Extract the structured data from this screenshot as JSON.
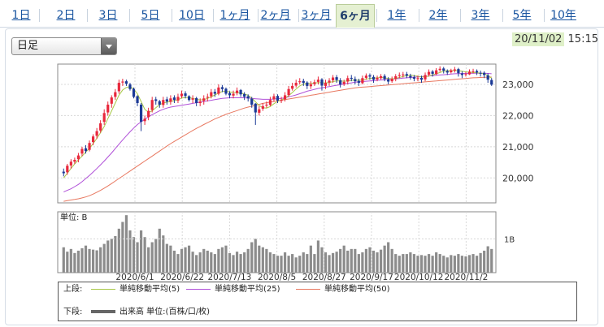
{
  "tabs": [
    {
      "label": "1日",
      "active": false
    },
    {
      "label": "2日",
      "active": false
    },
    {
      "label": "3日",
      "active": false
    },
    {
      "label": "5日",
      "active": false
    },
    {
      "label": "10日",
      "active": false
    },
    {
      "label": "1ヶ月",
      "active": false
    },
    {
      "label": "2ヶ月",
      "active": false
    },
    {
      "label": "3ヶ月",
      "active": false
    },
    {
      "label": "6ヶ月",
      "active": true
    },
    {
      "label": "1年",
      "active": false
    },
    {
      "label": "2年",
      "active": false
    },
    {
      "label": "3年",
      "active": false
    },
    {
      "label": "5年",
      "active": false
    },
    {
      "label": "10年",
      "active": false
    }
  ],
  "period_select": {
    "value": "日足"
  },
  "datetime": {
    "date": "20/11/02",
    "time": "15:15"
  },
  "legend": {
    "upper_label": "上段:",
    "lower_label": "下段:",
    "upper_items": [
      {
        "name": "単純移動平均(5)",
        "color": "#a8c848"
      },
      {
        "name": "単純移動平均(25)",
        "color": "#b050d8"
      },
      {
        "name": "単純移動平均(50)",
        "color": "#e87860"
      }
    ],
    "lower_item": {
      "name": "出来高 単位:(百株/口/枚)",
      "color": "#666666"
    }
  },
  "chart_data": {
    "type": "candlestick",
    "price_axis": {
      "ticks": [
        "20,000",
        "21,000",
        "22,000",
        "23,000"
      ],
      "ylim": [
        19200,
        23650
      ]
    },
    "volume_axis": {
      "unit_label": "単位: B",
      "ticks": [
        "1B"
      ],
      "ylim": [
        0,
        1.8
      ]
    },
    "x_labels": [
      "2020/6/1",
      "2020/6/22",
      "2020/7/13",
      "2020/8/5",
      "2020/8/27",
      "2020/9/17",
      "2020/10/12",
      "2020/11/2"
    ],
    "candles": {
      "close": [
        20150,
        20390,
        20520,
        20580,
        20720,
        20930,
        20860,
        21120,
        21330,
        21500,
        21750,
        22080,
        22350,
        22580,
        22750,
        23050,
        23090,
        23020,
        22850,
        22600,
        22400,
        21800,
        21900,
        22150,
        22500,
        22470,
        22350,
        22500,
        22450,
        22550,
        22500,
        22600,
        22700,
        22630,
        22500,
        22550,
        22400,
        22450,
        22550,
        22600,
        22750,
        22700,
        22900,
        22850,
        22700,
        22650,
        22700,
        22800,
        22680,
        22600,
        22550,
        22350,
        22100,
        22200,
        22300,
        22350,
        22500,
        22620,
        22480,
        22500,
        22650,
        22850,
        22950,
        23050,
        23100,
        23050,
        22950,
        23000,
        23070,
        23150,
        22960,
        23050,
        23120,
        23220,
        23140,
        23000,
        23080,
        23200,
        23180,
        23100,
        23050,
        23200,
        23280,
        23250,
        23150,
        23210,
        23260,
        23170,
        23090,
        23180,
        23260,
        23300,
        23320,
        23280,
        23220,
        23180,
        23200,
        23150,
        23300,
        23400,
        23340,
        23450,
        23500,
        23440,
        23380,
        23450,
        23480,
        23360,
        23300,
        23330,
        23410,
        23420,
        23380,
        23360,
        23300,
        23150,
        22990
      ],
      "open": [
        20200,
        20180,
        20400,
        20520,
        20600,
        20780,
        20950,
        20900,
        21150,
        21350,
        21520,
        21800,
        22100,
        22380,
        22600,
        22780,
        23060,
        23100,
        23000,
        22860,
        22620,
        22350,
        21820,
        21950,
        22180,
        22520,
        22460,
        22340,
        22520,
        22440,
        22580,
        22480,
        22620,
        22710,
        22620,
        22510,
        22560,
        22400,
        22470,
        22570,
        22620,
        22760,
        22700,
        22910,
        22860,
        22720,
        22640,
        22720,
        22820,
        22690,
        22620,
        22540,
        22380,
        22090,
        22220,
        22320,
        22340,
        22520,
        22630,
        22470,
        22520,
        22660,
        22860,
        22960,
        23070,
        23110,
        23060,
        22940,
        23010,
        23080,
        23160,
        22950,
        23060,
        23130,
        23230,
        23130,
        23010,
        23090,
        23210,
        23170,
        23110,
        23040,
        23210,
        23290,
        23240,
        23160,
        23200,
        23270,
        23160,
        23100,
        23170,
        23270,
        23290,
        23330,
        23270,
        23230,
        23170,
        23210,
        23160,
        23310,
        23410,
        23330,
        23460,
        23510,
        23430,
        23390,
        23440,
        23490,
        23350,
        23310,
        23320,
        23420,
        23430,
        23370,
        23370,
        23290,
        23140
      ],
      "high": [
        20300,
        20450,
        20600,
        20650,
        20800,
        21000,
        21050,
        21200,
        21400,
        21600,
        21850,
        22200,
        22450,
        22650,
        22850,
        23150,
        23180,
        23150,
        23050,
        22900,
        22650,
        22400,
        22000,
        22250,
        22600,
        22600,
        22500,
        22600,
        22600,
        22650,
        22650,
        22700,
        22800,
        22780,
        22650,
        22650,
        22600,
        22550,
        22650,
        22700,
        22850,
        22850,
        23000,
        22980,
        22900,
        22780,
        22800,
        22900,
        22850,
        22750,
        22680,
        22600,
        22400,
        22300,
        22400,
        22450,
        22600,
        22700,
        22680,
        22600,
        22750,
        22950,
        23050,
        23150,
        23200,
        23180,
        23100,
        23100,
        23150,
        23250,
        23200,
        23150,
        23200,
        23300,
        23300,
        23200,
        23150,
        23280,
        23300,
        23250,
        23180,
        23280,
        23350,
        23350,
        23300,
        23280,
        23330,
        23330,
        23230,
        23250,
        23330,
        23380,
        23400,
        23400,
        23340,
        23300,
        23280,
        23280,
        23380,
        23480,
        23460,
        23520,
        23580,
        23560,
        23480,
        23500,
        23560,
        23530,
        23420,
        23400,
        23480,
        23500,
        23480,
        23440,
        23420,
        23350,
        23200
      ],
      "low": [
        20050,
        20100,
        20300,
        20450,
        20500,
        20700,
        20780,
        20850,
        21050,
        21250,
        21450,
        21700,
        22000,
        22250,
        22500,
        22700,
        22950,
        22950,
        22800,
        22550,
        22300,
        21500,
        21700,
        21850,
        22100,
        22350,
        22250,
        22250,
        22350,
        22350,
        22400,
        22400,
        22550,
        22550,
        22450,
        22400,
        22300,
        22300,
        22350,
        22450,
        22550,
        22600,
        22650,
        22750,
        22650,
        22550,
        22550,
        22650,
        22600,
        22500,
        22450,
        22250,
        21700,
        22000,
        22150,
        22250,
        22300,
        22450,
        22400,
        22400,
        22450,
        22600,
        22800,
        22900,
        23000,
        22950,
        22850,
        22850,
        22950,
        23000,
        22800,
        22850,
        22950,
        23050,
        23050,
        22900,
        22950,
        23000,
        23100,
        23000,
        22950,
        23000,
        23150,
        23150,
        23050,
        23100,
        23150,
        23100,
        23000,
        23050,
        23100,
        23200,
        23220,
        23200,
        23150,
        23100,
        23100,
        23050,
        23100,
        23250,
        23250,
        23300,
        23400,
        23350,
        23300,
        23350,
        23380,
        23250,
        23200,
        23250,
        23300,
        23350,
        23300,
        23250,
        23200,
        23050,
        22950
      ]
    },
    "sma5": [
      20000,
      20150,
      20300,
      20450,
      20580,
      20700,
      20830,
      20950,
      21100,
      21270,
      21450,
      21650,
      21900,
      22150,
      22400,
      22650,
      22820,
      22900,
      22930,
      22850,
      22700,
      22450,
      22200,
      22100,
      22150,
      22250,
      22350,
      22400,
      22430,
      22450,
      22480,
      22510,
      22560,
      22580,
      22580,
      22550,
      22520,
      22500,
      22510,
      22550,
      22600,
      22660,
      22720,
      22770,
      22780,
      22760,
      22740,
      22730,
      22720,
      22690,
      22650,
      22560,
      22440,
      22320,
      22250,
      22240,
      22290,
      22380,
      22450,
      22500,
      22560,
      22640,
      22740,
      22850,
      22950,
      23010,
      23030,
      23030,
      23040,
      23060,
      23050,
      23050,
      23060,
      23090,
      23110,
      23110,
      23100,
      23110,
      23130,
      23140,
      23130,
      23140,
      23170,
      23190,
      23200,
      23210,
      23220,
      23210,
      23190,
      23180,
      23190,
      23220,
      23250,
      23280,
      23290,
      23280,
      23260,
      23240,
      23240,
      23270,
      23300,
      23340,
      23380,
      23420,
      23440,
      23440,
      23450,
      23440,
      23420,
      23400,
      23390,
      23380,
      23370,
      23360,
      23340,
      23280,
      23200
    ],
    "sma25": [
      19550,
      19600,
      19650,
      19720,
      19790,
      19880,
      19980,
      20080,
      20190,
      20300,
      20420,
      20540,
      20670,
      20800,
      20940,
      21080,
      21220,
      21350,
      21480,
      21600,
      21710,
      21800,
      21880,
      21960,
      22030,
      22090,
      22150,
      22200,
      22240,
      22270,
      22290,
      22310,
      22330,
      22350,
      22370,
      22390,
      22410,
      22430,
      22450,
      22470,
      22490,
      22510,
      22530,
      22550,
      22560,
      22570,
      22570,
      22570,
      22570,
      22570,
      22560,
      22550,
      22540,
      22530,
      22520,
      22520,
      22520,
      22530,
      22540,
      22550,
      22570,
      22600,
      22630,
      22660,
      22700,
      22740,
      22780,
      22810,
      22840,
      22870,
      22890,
      22910,
      22930,
      22950,
      22970,
      22990,
      23010,
      23030,
      23050,
      23070,
      23080,
      23090,
      23100,
      23110,
      23120,
      23130,
      23140,
      23150,
      23160,
      23170,
      23180,
      23190,
      23200,
      23210,
      23220,
      23230,
      23240,
      23250,
      23260,
      23270,
      23280,
      23290,
      23300,
      23310,
      23320,
      23330,
      23340,
      23345,
      23350,
      23352,
      23354,
      23356,
      23357,
      23357,
      23356,
      23350,
      23340
    ],
    "sma50": [
      19250,
      19270,
      19290,
      19310,
      19330,
      19360,
      19390,
      19430,
      19480,
      19540,
      19600,
      19670,
      19740,
      19820,
      19900,
      19980,
      20060,
      20140,
      20220,
      20300,
      20380,
      20460,
      20540,
      20620,
      20700,
      20780,
      20860,
      20940,
      21020,
      21100,
      21170,
      21240,
      21310,
      21380,
      21450,
      21520,
      21590,
      21650,
      21710,
      21770,
      21830,
      21890,
      21940,
      21990,
      22040,
      22080,
      22120,
      22160,
      22200,
      22240,
      22270,
      22300,
      22330,
      22360,
      22390,
      22410,
      22430,
      22450,
      22470,
      22490,
      22510,
      22530,
      22550,
      22570,
      22590,
      22610,
      22630,
      22650,
      22670,
      22690,
      22710,
      22730,
      22750,
      22770,
      22790,
      22810,
      22830,
      22850,
      22870,
      22890,
      22900,
      22910,
      22920,
      22930,
      22940,
      22950,
      22960,
      22970,
      22980,
      22990,
      23000,
      23010,
      23020,
      23030,
      23040,
      23050,
      23060,
      23070,
      23080,
      23090,
      23100,
      23110,
      23120,
      23130,
      23140,
      23150,
      23160,
      23170,
      23180,
      23190,
      23200,
      23210,
      23215,
      23220,
      23225,
      23230,
      23235
    ],
    "volume": [
      0.75,
      0.62,
      0.7,
      0.58,
      0.65,
      0.72,
      0.8,
      0.7,
      0.68,
      0.66,
      0.75,
      0.85,
      0.95,
      1.0,
      1.08,
      1.3,
      1.5,
      1.7,
      1.25,
      1.05,
      0.9,
      1.25,
      1.05,
      0.75,
      0.9,
      1.0,
      1.3,
      1.1,
      0.85,
      0.8,
      0.65,
      0.55,
      0.7,
      0.75,
      0.8,
      0.62,
      0.52,
      0.6,
      0.7,
      0.65,
      0.6,
      0.55,
      0.7,
      0.75,
      0.8,
      0.58,
      0.52,
      0.62,
      0.55,
      0.6,
      0.7,
      0.9,
      1.0,
      0.8,
      0.75,
      0.7,
      0.6,
      0.55,
      0.5,
      0.5,
      0.6,
      0.5,
      0.55,
      0.45,
      0.5,
      0.6,
      0.55,
      0.8,
      0.55,
      0.95,
      0.75,
      0.6,
      0.52,
      0.58,
      0.62,
      0.7,
      0.8,
      0.65,
      0.7,
      0.7,
      0.55,
      0.6,
      0.7,
      0.75,
      0.65,
      0.6,
      0.68,
      0.8,
      0.9,
      0.7,
      0.55,
      0.5,
      0.55,
      0.55,
      0.6,
      0.55,
      0.5,
      0.52,
      0.5,
      0.55,
      0.5,
      0.6,
      0.55,
      0.5,
      0.45,
      0.52,
      0.5,
      0.55,
      0.5,
      0.48,
      0.52,
      0.55,
      0.5,
      0.58,
      0.65,
      0.78,
      0.7
    ]
  }
}
